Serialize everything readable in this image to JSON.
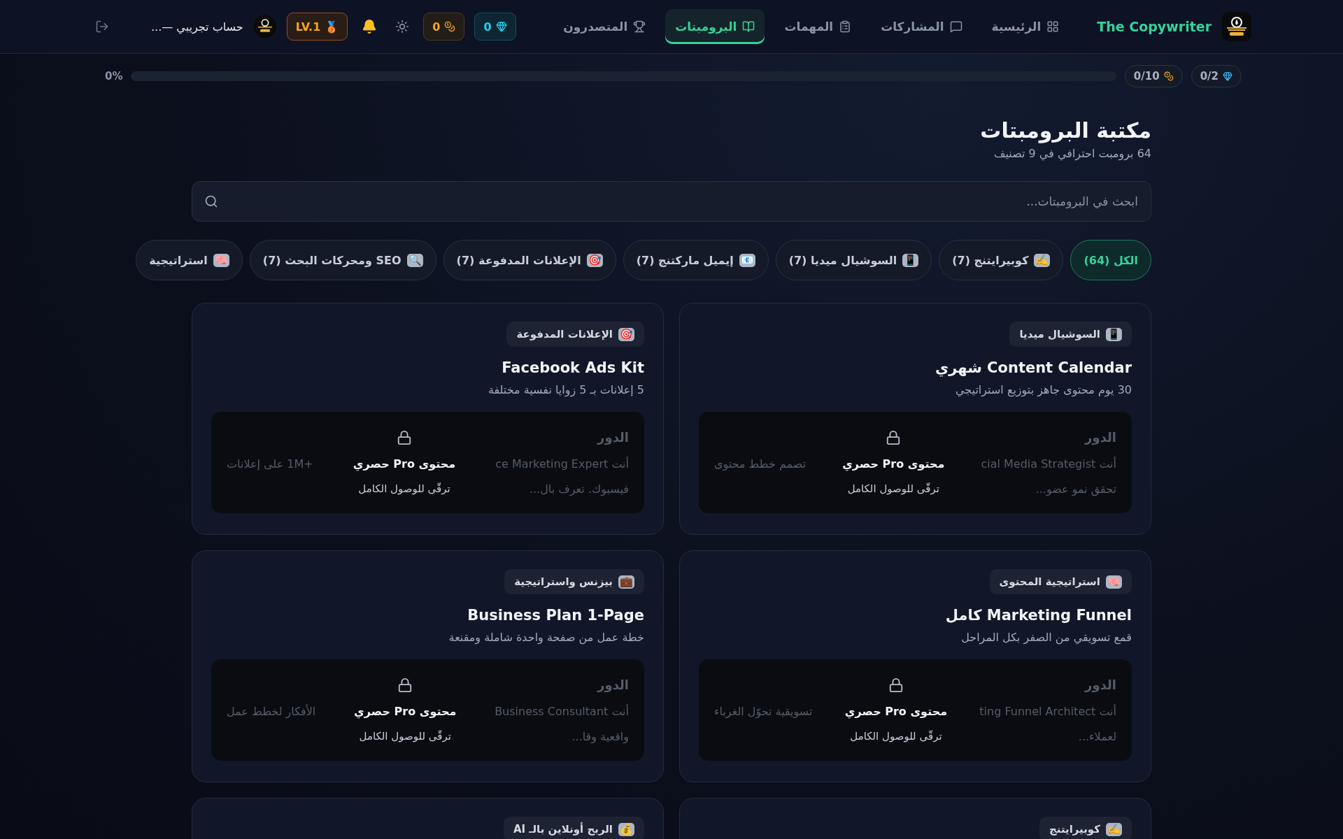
{
  "header": {
    "brand": "The Copywriter",
    "nav": [
      {
        "label": "الرئيسية",
        "selected": false
      },
      {
        "label": "المشاركات",
        "selected": false
      },
      {
        "label": "المهمات",
        "selected": false
      },
      {
        "label": "البرومبتات",
        "selected": true
      },
      {
        "label": "المتصدرون",
        "selected": false
      }
    ],
    "gems": "0",
    "coins": "0",
    "level_badge": "LV.1",
    "medal": "🥉",
    "user_name": "حساب تجريبي —..."
  },
  "progress": {
    "gems": "0/2",
    "coins": "0/10",
    "level": 0,
    "percent": "0%"
  },
  "page": {
    "title": "مكتبة البرومبتات",
    "subtitle": "64 برومبت احترافي في 9 تصنيف"
  },
  "search": {
    "placeholder": "ابحث في البرومبتات..."
  },
  "categories": [
    {
      "label": "الكل (64)",
      "selected": true
    },
    {
      "emoji": "✍️",
      "label": "كوبيرايتنج (7)",
      "selected": false
    },
    {
      "emoji": "📱",
      "label": "السوشيال ميديا (7)",
      "selected": false
    },
    {
      "emoji": "📧",
      "label": "إيميل ماركتنج (7)",
      "selected": false
    },
    {
      "emoji": "🎯",
      "label": "الإعلانات المدفوعة (7)",
      "selected": false
    },
    {
      "emoji": "🔍",
      "label": "SEO ومحركات البحث (7)",
      "selected": false
    },
    {
      "emoji": "🧠",
      "label": "استراتيجية",
      "selected": false
    }
  ],
  "cards": [
    {
      "tag_emoji": "📱",
      "tag": "السوشيال ميديا",
      "title": "Content Calendar شهري",
      "description": "30 يوم محتوى جاهز بتوزيع استراتيجي",
      "locked": true,
      "role_label": "الدور",
      "preview_right": "أنت cial Media Strategist",
      "preview_left": "تصمم خطط محتوى",
      "preview_line2": "تحقق نمو عضو...",
      "lock_title": "محتوى Pro حصري",
      "lock_subtitle": "ترقّى للوصول الكامل"
    },
    {
      "tag_emoji": "🎯",
      "tag": "الإعلانات المدفوعة",
      "title": "Facebook Ads Kit",
      "description": "5 إعلانات بـ 5 زوايا نفسية مختلفة",
      "locked": true,
      "role_label": "الدور",
      "preview_right": "أنت ce Marketing Expert",
      "preview_left": "+1M على إعلانات",
      "preview_line2": "فيسبوك. تعرف بال...",
      "lock_title": "محتوى Pro حصري",
      "lock_subtitle": "ترقّى للوصول الكامل"
    },
    {
      "tag_emoji": "🧠",
      "tag": "استراتيجية المحتوى",
      "title": "Marketing Funnel كامل",
      "description": "قمع تسويقي من الصفر بكل المراحل",
      "locked": true,
      "role_label": "الدور",
      "preview_right": "أنت ting Funnel Architect",
      "preview_left": "تسويقية تحوّل الغرباء",
      "preview_line2": "لعملاء...",
      "lock_title": "محتوى Pro حصري",
      "lock_subtitle": "ترقّى للوصول الكامل"
    },
    {
      "tag_emoji": "💼",
      "tag": "بيزنس واستراتيجية",
      "title": "Business Plan 1-Page",
      "description": "خطة عمل من صفحة واحدة شاملة ومقنعة",
      "locked": true,
      "role_label": "الدور",
      "preview_right": "أنت Business Consultant",
      "preview_left": "الأفكار لخطط عمل",
      "preview_line2": "واقعية وقا...",
      "lock_title": "محتوى Pro حصري",
      "lock_subtitle": "ترقّى للوصول الكامل"
    },
    {
      "tag_emoji": "✍️",
      "tag": "كوبيرايتنج"
    },
    {
      "tag_emoji": "💰",
      "tag": "الربح أونلاين بالـ AI"
    }
  ]
}
